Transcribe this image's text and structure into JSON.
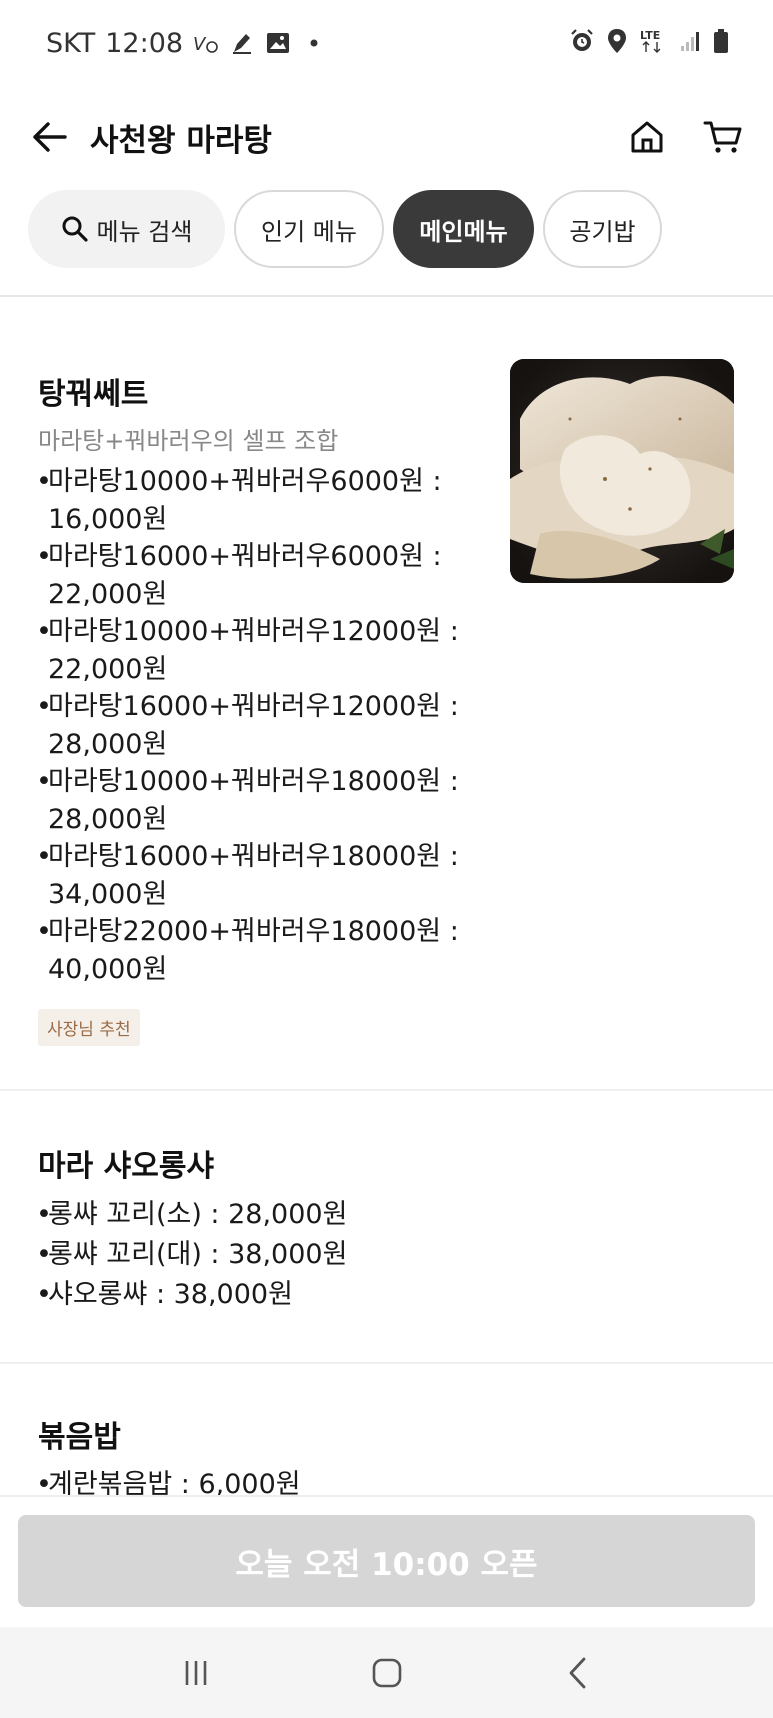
{
  "status_bar": {
    "carrier": "SKT",
    "time": "12:08",
    "network": "LTE"
  },
  "header": {
    "title": "사천왕 마라탕"
  },
  "chips": {
    "search_label": "메뉴 검색",
    "items": [
      {
        "label": "인기 메뉴",
        "active": false
      },
      {
        "label": "메인메뉴",
        "active": true
      },
      {
        "label": "공기밥",
        "active": false
      }
    ]
  },
  "sections": [
    {
      "title": "탕꿔쎄트",
      "subtitle": "마라탕+꿔바러우의 셀프 조합",
      "lines": [
        "마라탕10000+꿔바러우6000원 :\n16,000원",
        "마라탕16000+꿔바러우6000원 :\n22,000원",
        "마라탕10000+꿔바러우12000원 :\n22,000원",
        "마라탕16000+꿔바러우12000원 :\n28,000원",
        "마라탕10000+꿔바러우18000원 :\n28,000원",
        "마라탕16000+꿔바러우18000원 :\n34,000원",
        "마라탕22000+꿔바러우18000원 :\n40,000원"
      ],
      "badge": "사장님 추천"
    },
    {
      "title": "마라 샤오롱샤",
      "lines": [
        "롱쌰 꼬리(소) : 28,000원",
        "롱쌰 꼬리(대) : 38,000원",
        "샤오롱쌰 : 38,000원"
      ]
    },
    {
      "title": "볶음밥",
      "lines": [
        "계란볶음밥 : 6,000원"
      ]
    }
  ],
  "cta": {
    "label": "오늘 오전 10:00 오픈"
  },
  "colors": {
    "active_chip": "#3a3a3a",
    "cta_disabled": "#d6d6d6",
    "badge_text": "#9a6b45",
    "badge_bg": "#f4efe8"
  }
}
